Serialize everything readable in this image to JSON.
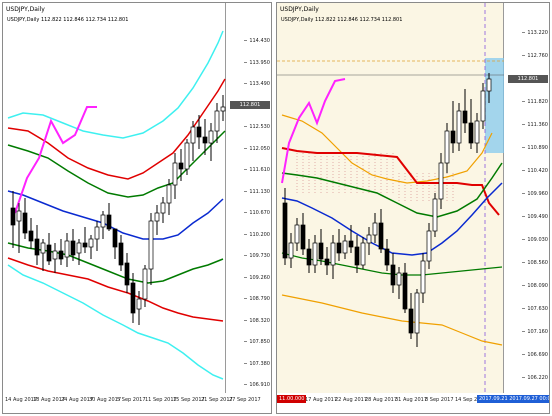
{
  "left": {
    "title": "USDJPY,Daily",
    "info": "USDJPY,Daily  112.822 112.846 112.734 112.801",
    "price_tag": "112.801",
    "y_ticks": [
      "114.430",
      "113.950",
      "113.490",
      "113.010",
      "112.530",
      "112.050",
      "111.610",
      "111.130",
      "110.670",
      "110.200",
      "109.730",
      "109.260",
      "108.790",
      "108.320",
      "107.850",
      "107.380",
      "106.910",
      "106.440"
    ],
    "x_ticks": [
      "14 Aug 2017",
      "18 Aug 2017",
      "24 Aug 2017",
      "30 Aug 2017",
      "5 Sep 2017",
      "11 Sep 2017",
      "15 Sep 2017",
      "21 Sep 2017",
      "27 Sep 2017"
    ]
  },
  "right": {
    "title": "USDJPY,Daily",
    "info": "USDJPY,Daily  112.822 112.846 112.734 112.801",
    "price_tag": "112.801",
    "y_ticks": [
      "113.220",
      "112.760",
      "112.290",
      "111.820",
      "111.360",
      "110.890",
      "110.420",
      "109.960",
      "109.490",
      "109.030",
      "108.560",
      "108.090",
      "107.630",
      "107.160",
      "106.690",
      "106.220"
    ],
    "x_ticks": [
      "17 Aug 2017",
      "22 Aug 2017",
      "28 Aug 2017",
      "31 Aug 2017",
      "8 Sep 2017",
      "14 Sep 2017"
    ],
    "red_tag": "11.00.000",
    "blue_tag": "2017.09.21 2017.09.27 00:00"
  },
  "colors": {
    "bull_candle": "#ffffff",
    "bear_candle": "#000000",
    "red_line": "#e00000",
    "green_line": "#007a00",
    "blue_line": "#0a2ad0",
    "cyan_line": "#3ef0f0",
    "magenta_line": "#ff22ff",
    "orange_line": "#f0a000",
    "box_fill": "#7ec8f0"
  }
}
